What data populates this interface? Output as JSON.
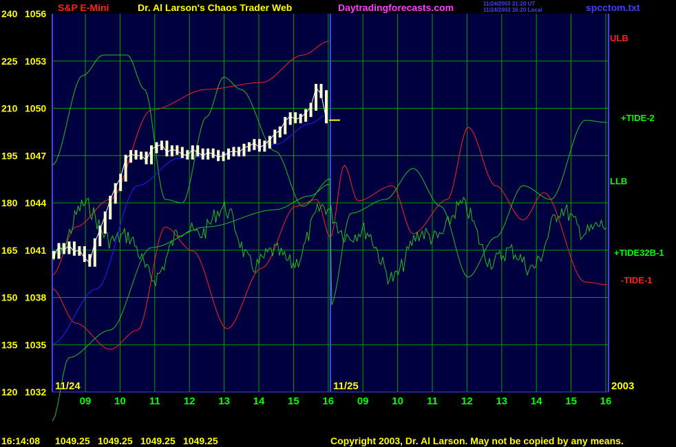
{
  "header": {
    "symbol": "S&P E-Mini",
    "title": "Dr. Al Larson's Chaos Trader Web",
    "site": "Daytradingforecasts.com",
    "ut_line": "11/24/2003 21:20 UT",
    "local_line": "11/24/2003 16:20 Local",
    "filename": "spcctom.txt"
  },
  "footer": {
    "time": "16:14:08",
    "ohlc": [
      "1049.25",
      "1049.25",
      "1049.25",
      "1049.25"
    ],
    "copyright": "Copyright 2003, Dr. Al Larson. May not be copied by any means."
  },
  "colors": {
    "plot_bg": "#000040",
    "grid": "#00a000",
    "axis_line": "#4040ff",
    "price": "#ffffcc",
    "red": "#ff2020",
    "green": "#20c020",
    "blue": "#2020ff",
    "magenta": "#ff40ff",
    "yellow": "#ffff00",
    "header_red": "#ff2020",
    "date_yellow": "#ffff00",
    "label_green": "#00ff00"
  },
  "chart_data": {
    "type": "line",
    "left_axis_outer": [
      "240",
      "225",
      "210",
      "195",
      "180",
      "165",
      "150",
      "135",
      "120"
    ],
    "left_axis_price": [
      "1056",
      "1053",
      "1050",
      "1047",
      "1044",
      "1041",
      "1038",
      "1035",
      "1032"
    ],
    "ylim_price": [
      1032,
      1056
    ],
    "x_ticks": [
      "09",
      "10",
      "11",
      "12",
      "13",
      "14",
      "15",
      "16",
      "09",
      "10",
      "11",
      "12",
      "13",
      "14",
      "15",
      "16"
    ],
    "date_labels": [
      "11/24",
      "11/25",
      "2003"
    ],
    "series_labels": [
      {
        "text": "ULB",
        "color": "#ff2020"
      },
      {
        "text": "+TIDE-2",
        "color": "#00ff00"
      },
      {
        "text": "LLB",
        "color": "#00ff00"
      },
      {
        "text": "+TIDE32B-1",
        "color": "#00ff00"
      },
      {
        "text": "-TIDE-1",
        "color": "#ff2020"
      }
    ],
    "price_bars_close": [
      1040.7,
      1041.2,
      1041.0,
      1041.3,
      1040.9,
      1041.0,
      1040.5,
      1040.2,
      1041.5,
      1042.3,
      1043.2,
      1044.2,
      1045.0,
      1045.6,
      1046.8,
      1047.1,
      1047.0,
      1047.0,
      1046.7,
      1047.4,
      1047.6,
      1047.7,
      1047.2,
      1047.4,
      1047.3,
      1047.1,
      1047.0,
      1047.4,
      1047.2,
      1047.0,
      1047.2,
      1047.1,
      1046.9,
      1047.0,
      1047.2,
      1047.3,
      1047.2,
      1047.5,
      1047.6,
      1047.8,
      1047.5,
      1047.7,
      1048.0,
      1048.4,
      1048.6,
      1049.2,
      1049.5,
      1049.3,
      1049.4,
      1049.7,
      1050.1,
      1051.3,
      1050.9,
      1049.3
    ]
  }
}
